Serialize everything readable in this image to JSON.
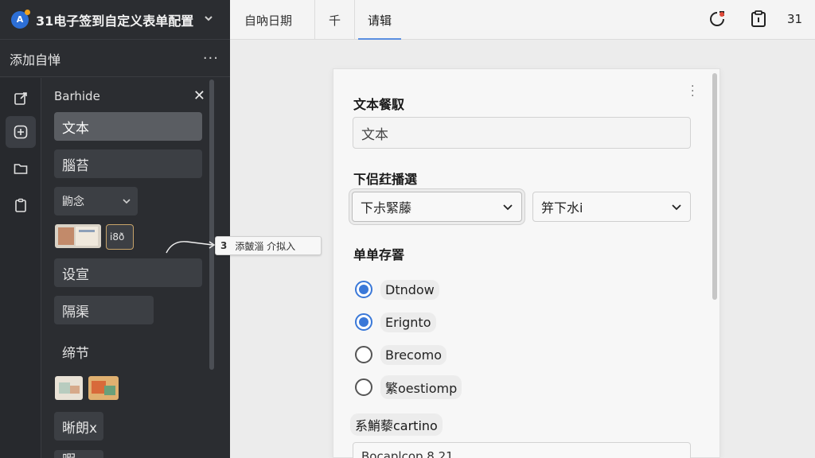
{
  "app": {
    "logo_letter": "A",
    "title": "31电子签到自定义表单配置"
  },
  "panel": {
    "title": "添加自惮",
    "more": "···"
  },
  "components": {
    "title": "Barhide",
    "items": [
      "文本",
      "腦苔",
      "鼩念",
      "i8ð",
      "设宣",
      "隔渠",
      "缔节",
      "晰朗x",
      "暇"
    ]
  },
  "hint": {
    "number": "3",
    "text": "添皼淄 介拟入"
  },
  "tabs": [
    "自吶日期",
    "千",
    "请辑"
  ],
  "top_number": "31",
  "form": {
    "field1": {
      "label": "文本餐馭",
      "value": "文本"
    },
    "field2": {
      "label": "下侣荭播選",
      "select1": "下尗緊藤",
      "select2": "笄下水i"
    },
    "field3": {
      "label": "单单存罯",
      "options": [
        {
          "label": "Dtndow",
          "checked": true
        },
        {
          "label": "Erignto",
          "checked": true
        },
        {
          "label": "Brecomo",
          "checked": false
        },
        {
          "label": "繁oestiomp",
          "checked": false
        }
      ]
    },
    "field4": {
      "label": "系鮹藜cartino",
      "value": "Bocaplcop 8 21"
    }
  },
  "colors": {
    "accent": "#3a78d8",
    "sidebar": "#2b2d31",
    "logo": "#2d6fd6"
  }
}
